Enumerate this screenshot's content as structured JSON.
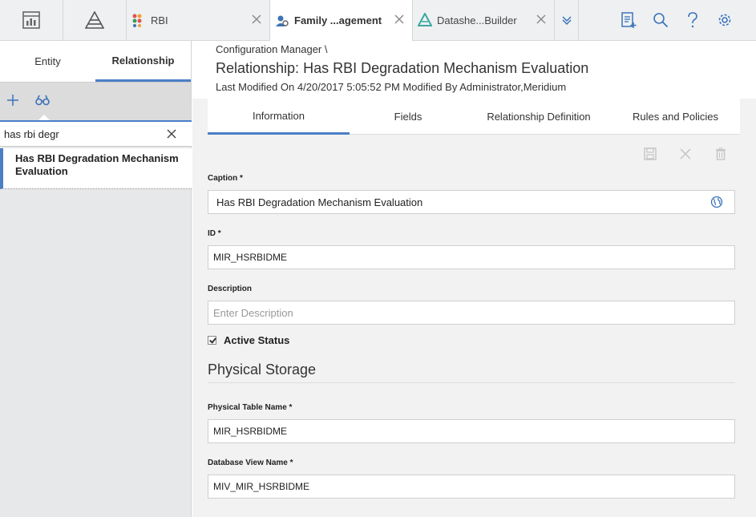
{
  "top_tabs": [
    {
      "label": "RBI",
      "icon": "rbi-dots-icon"
    },
    {
      "label": "Family ...agement",
      "icon": "family-management-icon"
    },
    {
      "label": "Datashe...Builder",
      "icon": "datasheet-builder-icon"
    }
  ],
  "left_panel": {
    "tabs": [
      "Entity",
      "Relationship"
    ],
    "search_value": "has rbi degr",
    "results": [
      "Has RBI Degradation Mechanism Evaluation"
    ]
  },
  "header": {
    "breadcrumb": "Configuration Manager \\",
    "title": "Relationship: Has RBI Degradation Mechanism Evaluation",
    "modified": "Last Modified On 4/20/2017 5:05:52 PM Modified By Administrator,Meridium"
  },
  "subtabs": [
    "Information",
    "Fields",
    "Relationship Definition",
    "Rules and Policies"
  ],
  "form": {
    "caption_label": "Caption *",
    "caption_value": "Has RBI Degradation Mechanism Evaluation",
    "id_label": "ID *",
    "id_value": "MIR_HSRBIDME",
    "description_label": "Description",
    "description_placeholder": "Enter Description",
    "active_label": "Active Status",
    "section_title": "Physical Storage",
    "table_label": "Physical Table Name *",
    "table_value": "MIR_HSRBIDME",
    "view_label": "Database View Name *",
    "view_value": "MIV_MIR_HSRBIDME"
  },
  "colors": {
    "accent": "#4a7fc7",
    "icon_blue": "#3b73b9"
  }
}
